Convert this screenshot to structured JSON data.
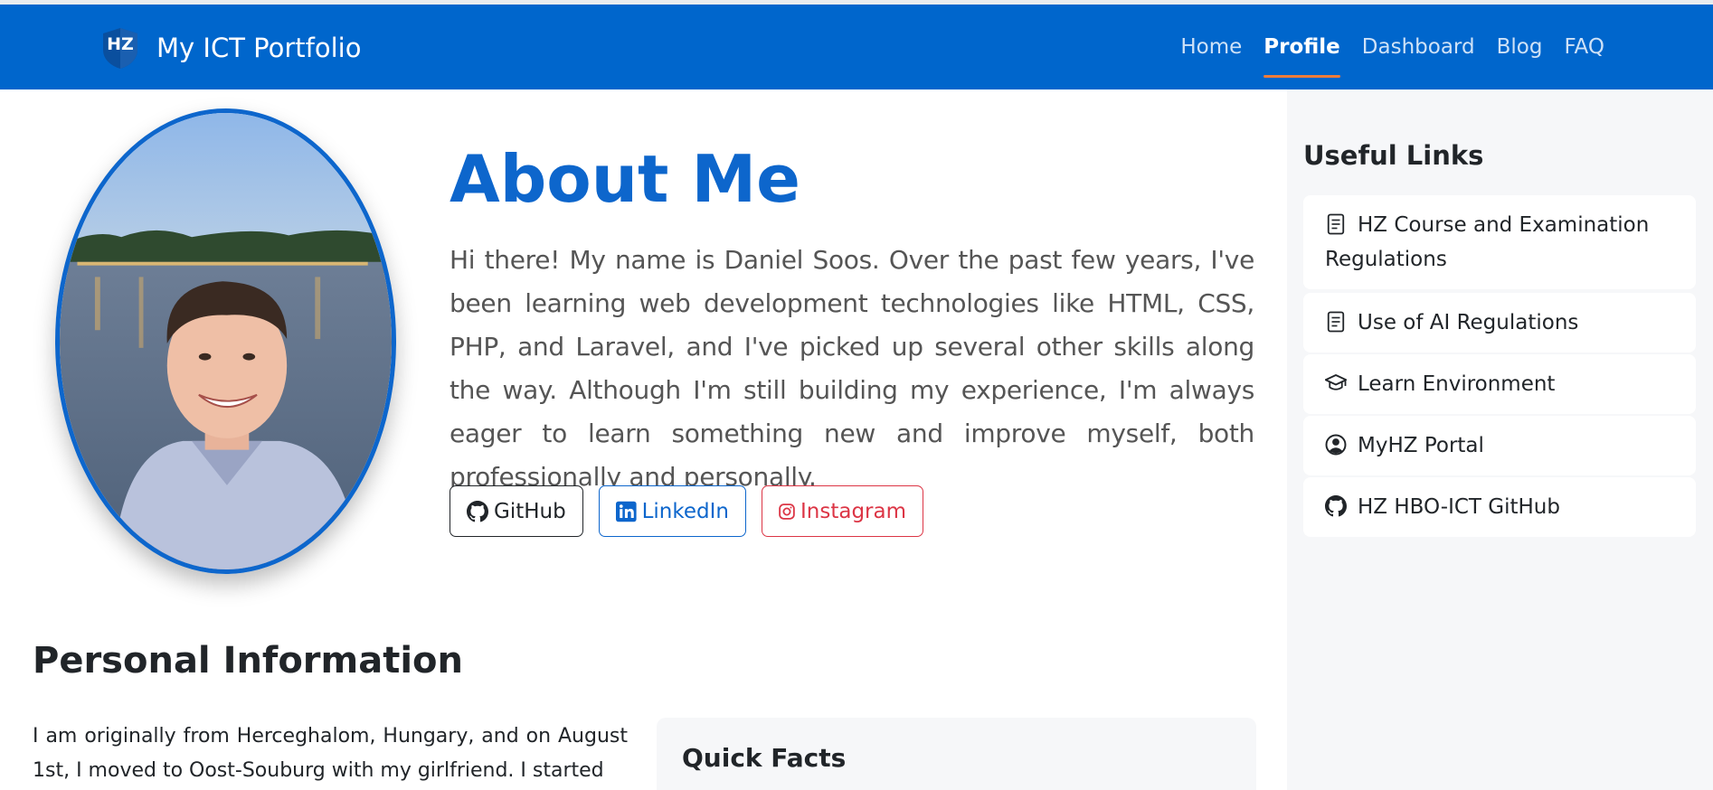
{
  "navbar": {
    "brand": "My ICT Portfolio",
    "logo_text": "HZ",
    "links": [
      {
        "label": "Home",
        "active": false
      },
      {
        "label": "Profile",
        "active": true
      },
      {
        "label": "Dashboard",
        "active": false
      },
      {
        "label": "Blog",
        "active": false
      },
      {
        "label": "FAQ",
        "active": false
      }
    ]
  },
  "about": {
    "title": "About Me",
    "text": "Hi there! My name is Daniel Soos. Over the past few years, I've been learning web development technologies like HTML, CSS, PHP, and Laravel, and I've picked up several other skills along the way. Although I'm still building my experience, I'm always eager to learn something new and improve myself, both professionally and personally."
  },
  "social": {
    "github": "GitHub",
    "linkedin": "LinkedIn",
    "instagram": "Instagram"
  },
  "sidebar": {
    "title": "Useful Links",
    "links": [
      {
        "label": "HZ Course and Examination Regulations",
        "icon": "document-icon"
      },
      {
        "label": "Use of AI Regulations",
        "icon": "document-icon"
      },
      {
        "label": "Learn Environment",
        "icon": "graduation-cap-icon"
      },
      {
        "label": "MyHZ Portal",
        "icon": "user-circle-icon"
      },
      {
        "label": "HZ HBO-ICT GitHub",
        "icon": "github-icon"
      }
    ]
  },
  "personal_info": {
    "title": "Personal Information",
    "text": "I am originally from Herceghalom, Hungary, and on August 1st, I moved to Oost-Souburg with my girlfriend. I started"
  },
  "quick_facts": {
    "title": "Quick Facts"
  },
  "colors": {
    "primary": "#0066cc",
    "nav_active_underline": "#f07c3a",
    "instagram": "#dc3545"
  }
}
